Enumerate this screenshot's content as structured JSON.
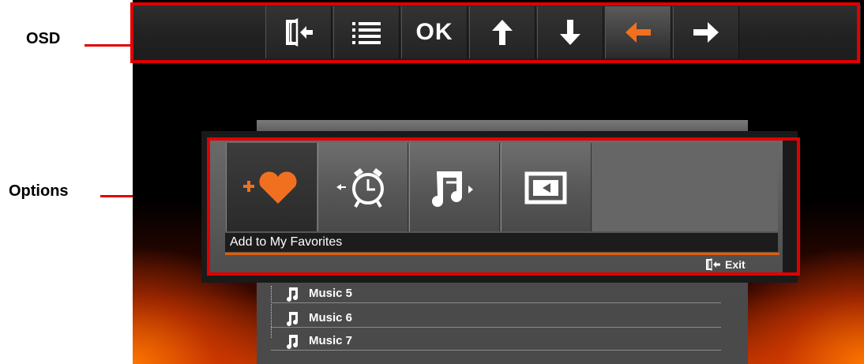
{
  "callouts": {
    "osd": "OSD",
    "options": "Options"
  },
  "osd": {
    "buttons": [
      {
        "name": "exit-icon",
        "label": ""
      },
      {
        "name": "menu-icon",
        "label": ""
      },
      {
        "name": "ok",
        "label": "OK"
      },
      {
        "name": "arrow-up-icon",
        "label": ""
      },
      {
        "name": "arrow-down-icon",
        "label": ""
      },
      {
        "name": "arrow-left-icon",
        "label": ""
      },
      {
        "name": "arrow-right-icon",
        "label": ""
      }
    ],
    "active_index": 5
  },
  "options": {
    "items": [
      {
        "icon": "add-favorite-icon"
      },
      {
        "icon": "alarm-clock-icon"
      },
      {
        "icon": "music-next-icon"
      },
      {
        "icon": "slideshow-icon"
      }
    ],
    "caption": "Add to My Favorites",
    "exit_label": "Exit"
  },
  "music_list": {
    "items": [
      "Music 5",
      "Music 6",
      "Music 7"
    ]
  },
  "colors": {
    "frame": "#e00000",
    "accent": "#f07020",
    "underline": "#e85a00"
  }
}
